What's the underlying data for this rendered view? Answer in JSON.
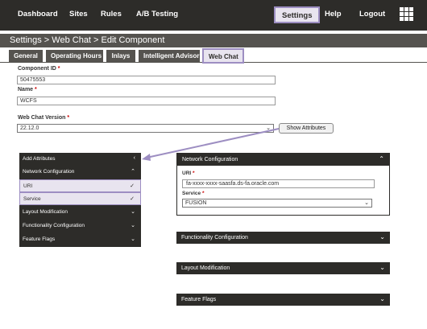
{
  "nav": {
    "items": [
      "Dashboard",
      "Sites",
      "Rules",
      "A/B Testing",
      "Settings",
      "Help",
      "Logout"
    ],
    "active": "Settings"
  },
  "breadcrumb": "Settings > Web Chat > Edit Component",
  "tabs": [
    "General",
    "Operating Hours",
    "Inlays",
    "Intelligent Advisor",
    "Web Chat"
  ],
  "active_tab": "Web Chat",
  "form": {
    "component_id_label": "Component ID",
    "component_id_value": "50475553",
    "name_label": "Name",
    "name_value": "WCFS",
    "version_label": "Web Chat Version",
    "version_value": "22.12.0",
    "required_mark": "*",
    "show_attributes_label": "Show Attributes"
  },
  "attributes_panel": {
    "items": [
      {
        "label": "Add Attributes",
        "icon": "chevron-left-icon"
      },
      {
        "label": "Network Configuration",
        "icon": "chevron-up-icon"
      },
      {
        "label": "URI",
        "icon": "check-icon"
      },
      {
        "label": "Service",
        "icon": "check-icon"
      },
      {
        "label": "Layout Modification",
        "icon": "chevron-down-icon"
      },
      {
        "label": "Functionality Configuration",
        "icon": "chevron-down-icon"
      },
      {
        "label": "Feature Flags",
        "icon": "chevron-down-icon"
      }
    ]
  },
  "network_config": {
    "title": "Network Configuration",
    "uri_label": "URI",
    "uri_value": "fa-xxxx-xxxx-saasfa.ds-fa.oracle.com",
    "service_label": "Service",
    "service_value": "FUSION"
  },
  "sections": [
    "Functionality Configuration",
    "Layout Modification",
    "Feature Flags"
  ],
  "colors": {
    "dark": "#2d2c29",
    "title_bar": "#55534f",
    "highlight_fill": "#e8e4ef",
    "highlight_border": "#9d8ec2",
    "required": "#cc0000"
  },
  "icons": {
    "grid": "grid-icon",
    "select_chevron": "chevron-down-icon"
  }
}
